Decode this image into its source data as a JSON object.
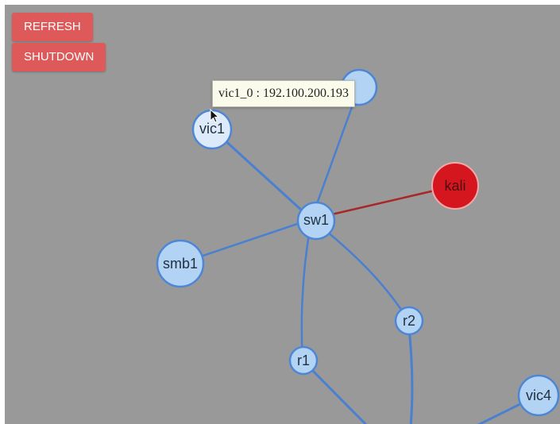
{
  "toolbar": {
    "refresh_label": "REFRESH",
    "shutdown_label": "SHUTDOWN"
  },
  "tooltip": {
    "text": "vic1_0 : 192.100.200.193"
  },
  "graph": {
    "nodes": [
      {
        "id": "node-hidden",
        "label": ""
      },
      {
        "id": "vic1",
        "label": "vic1"
      },
      {
        "id": "sw1",
        "label": "sw1"
      },
      {
        "id": "kali",
        "label": "kali"
      },
      {
        "id": "smb1",
        "label": "smb1"
      },
      {
        "id": "r2",
        "label": "r2"
      },
      {
        "id": "r1",
        "label": "r1"
      },
      {
        "id": "vic4",
        "label": "vic4"
      }
    ],
    "links": [
      {
        "from": "sw1",
        "to": "vic1",
        "status": "normal"
      },
      {
        "from": "sw1",
        "to": "node-hidden",
        "status": "normal"
      },
      {
        "from": "sw1",
        "to": "kali",
        "status": "alert"
      },
      {
        "from": "sw1",
        "to": "smb1",
        "status": "normal"
      },
      {
        "from": "sw1",
        "to": "r2",
        "status": "normal"
      },
      {
        "from": "sw1",
        "to": "r1",
        "status": "normal"
      },
      {
        "from": "r1",
        "to": "offscreen",
        "status": "normal"
      },
      {
        "from": "r2",
        "to": "offscreen",
        "status": "normal"
      },
      {
        "from": "vic4",
        "to": "offscreen",
        "status": "normal"
      }
    ]
  },
  "colors": {
    "background": "#999999",
    "node_fill": "#b3d3f4",
    "node_stroke": "#4e86d6",
    "link_normal": "#4a80d0",
    "link_alert": "#a82727",
    "alert_node_fill": "#d6161e",
    "alert_node_stroke": "#eeaaaa",
    "button_bg": "#de5a5a"
  },
  "icons": {
    "cursor": "arrow-cursor-icon"
  }
}
